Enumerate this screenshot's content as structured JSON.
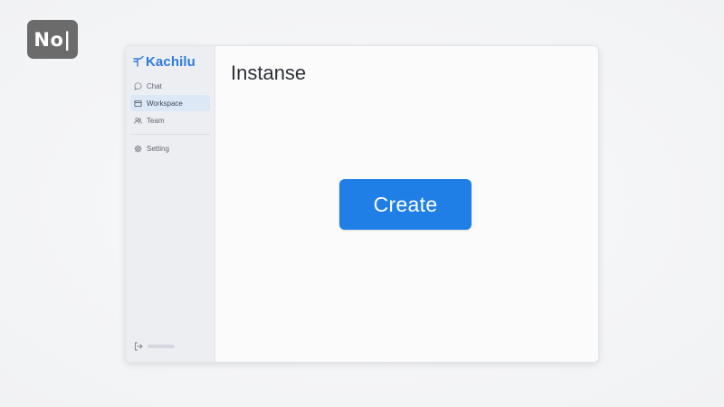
{
  "badge": {
    "text": "No|"
  },
  "app": {
    "brand": "Kachilu",
    "brand_color": "#2f7bd9"
  },
  "sidebar": {
    "items": [
      {
        "label": "Chat",
        "icon": "chat-bubble-icon",
        "active": false
      },
      {
        "label": "Workspace",
        "icon": "workspace-icon",
        "active": true
      },
      {
        "label": "Team",
        "icon": "team-icon",
        "active": false
      }
    ],
    "settings": {
      "label": "Setting",
      "icon": "gear-icon"
    },
    "logout": {
      "icon": "logout-icon"
    }
  },
  "main": {
    "title": "Instanse",
    "create_label": "Create",
    "accent_color": "#1f7fe6"
  }
}
